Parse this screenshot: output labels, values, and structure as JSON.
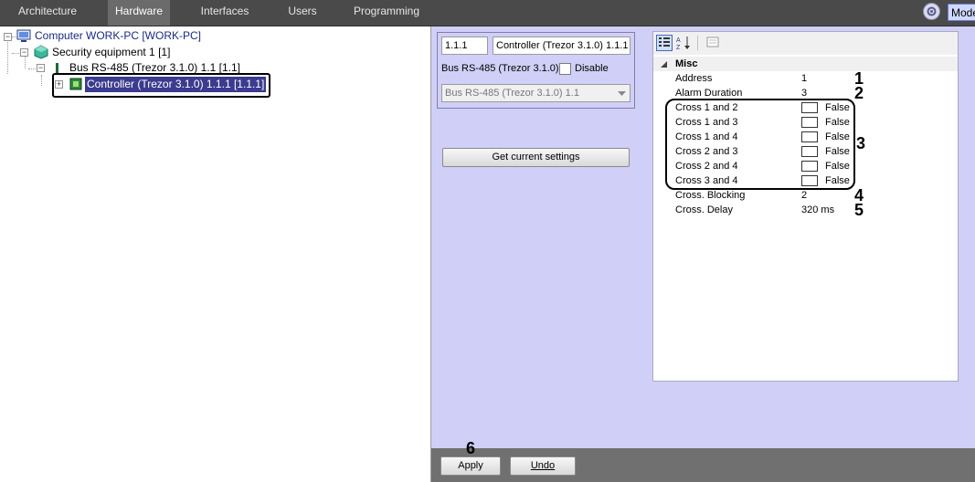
{
  "tabs": [
    {
      "label": "Architecture",
      "active": false
    },
    {
      "label": "Hardware",
      "active": true
    },
    {
      "label": "Interfaces",
      "active": false
    },
    {
      "label": "Users",
      "active": false
    },
    {
      "label": "Programming",
      "active": false
    }
  ],
  "mode_label": "Mode",
  "tree": {
    "computer": "Computer WORK-PC [WORK-PC]",
    "security": "Security equipment 1 [1]",
    "bus": "Bus RS-485 (Trezor 3.1.0) 1.1 [1.1]",
    "controller": "Controller (Trezor 3.1.0) 1.1.1 [1.1.1]"
  },
  "object": {
    "id_value": "1.1.1",
    "name_value": "Controller (Trezor 3.1.0) 1.1.1",
    "parent_label": "Bus RS-485 (Trezor 3.1.0)",
    "disable_label": "Disable",
    "disable_checked": false,
    "bus_select_value": "Bus RS-485 (Trezor 3.1.0) 1.1"
  },
  "get_settings_label": "Get current settings",
  "properties": {
    "category": "Misc",
    "rows": [
      {
        "name": "Address",
        "value": "1"
      },
      {
        "name": "Alarm Duration",
        "value": "3"
      },
      {
        "name": "Cross 1 and 2",
        "value": "False",
        "checkbox": true
      },
      {
        "name": "Cross 1 and 3",
        "value": "False",
        "checkbox": true
      },
      {
        "name": "Cross 1 and 4",
        "value": "False",
        "checkbox": true
      },
      {
        "name": "Cross 2 and 3",
        "value": "False",
        "checkbox": true
      },
      {
        "name": "Cross 2 and 4",
        "value": "False",
        "checkbox": true
      },
      {
        "name": "Cross 3 and 4",
        "value": "False",
        "checkbox": true
      },
      {
        "name": "Cross. Blocking",
        "value": "2"
      },
      {
        "name": "Cross. Delay",
        "value": "320 ms"
      }
    ]
  },
  "callouts": [
    "1",
    "2",
    "3",
    "4",
    "5",
    "6"
  ],
  "apply_label": "Apply",
  "undo_label": "Undo",
  "colors": {
    "topbar": "#4a4a4a",
    "panel": "#cfcff7",
    "tree_text": "#1a2a80",
    "selected_bg": "#3b3b8f"
  }
}
